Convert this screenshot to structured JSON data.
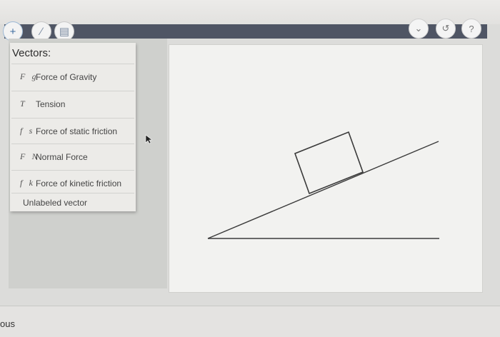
{
  "toolbar": {
    "tools": [
      {
        "icon": "plus-icon",
        "glyph": "+"
      },
      {
        "icon": "pencil-icon",
        "glyph": "∕"
      },
      {
        "icon": "trash-icon",
        "glyph": "▤"
      }
    ],
    "right_controls": [
      {
        "icon": "chevron-down-icon",
        "glyph": "⌄"
      },
      {
        "icon": "undo-icon",
        "glyph": "↺"
      },
      {
        "icon": "help-icon",
        "glyph": "?"
      }
    ]
  },
  "vector_menu": {
    "title": "Vectors:",
    "items": [
      {
        "symbol": "F⃗g",
        "label": "Force of Gravity"
      },
      {
        "symbol": "T⃗",
        "label": "Tension"
      },
      {
        "symbol": "f⃗s",
        "label": "Force of static friction"
      },
      {
        "symbol": "F⃗N",
        "label": "Normal Force"
      },
      {
        "symbol": "f⃗k",
        "label": "Force of kinetic friction"
      }
    ],
    "unlabeled": "Unlabeled vector"
  },
  "footer": {
    "previous_label": "ous"
  }
}
